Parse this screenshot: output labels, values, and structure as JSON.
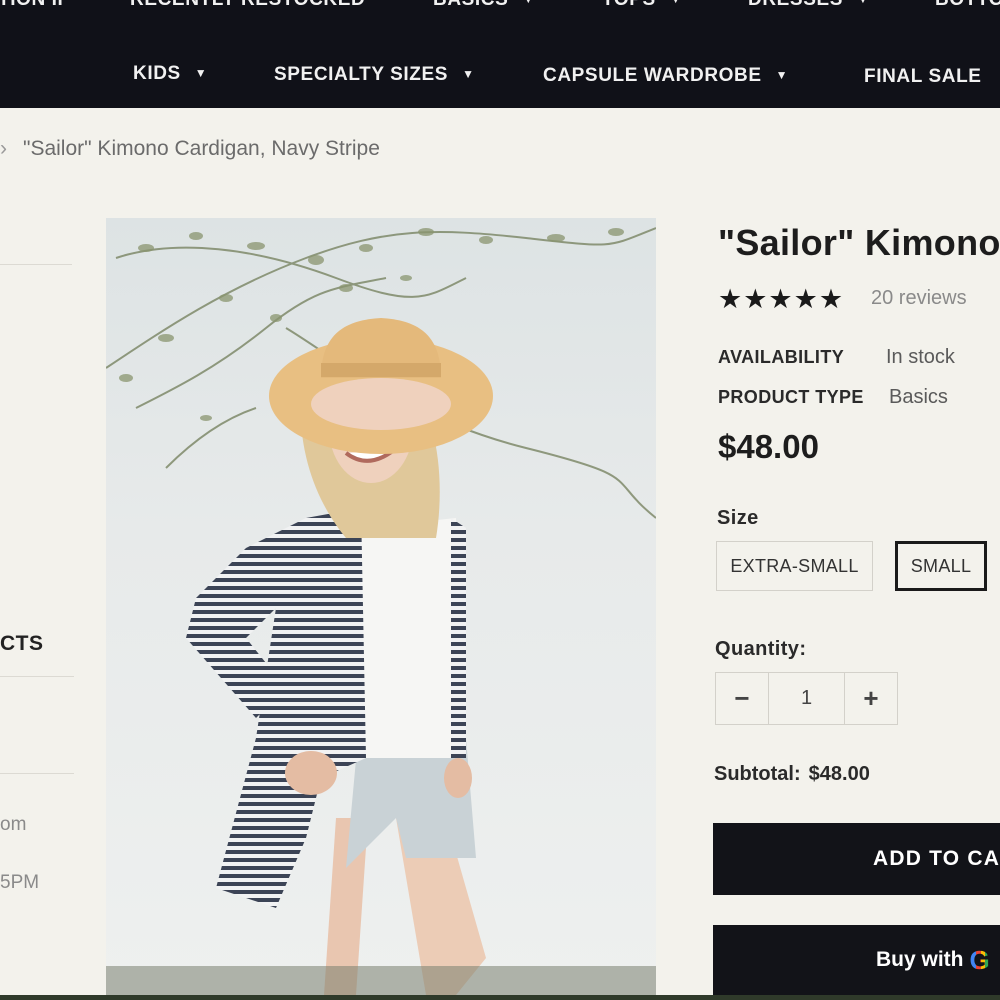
{
  "nav": {
    "top_row": [
      {
        "label": "TION II"
      },
      {
        "label": "RECENTLY RESTOCKED"
      },
      {
        "label": "BASICS"
      },
      {
        "label": "TOPS"
      },
      {
        "label": "DRESSES"
      },
      {
        "label": "BOTTO"
      }
    ],
    "bottom_row": [
      {
        "label": "KIDS"
      },
      {
        "label": "SPECIALTY SIZES"
      },
      {
        "label": "CAPSULE WARDROBE"
      },
      {
        "label": "FINAL SALE"
      }
    ]
  },
  "breadcrumb": {
    "separator": "›",
    "current": "\"Sailor\" Kimono Cardigan, Navy Stripe"
  },
  "sidebar": {
    "heading_fragment": "CTS",
    "text_fragment_1": "om",
    "text_fragment_2": "5PM"
  },
  "product": {
    "title": "\"Sailor\" Kimono",
    "rating_stars": "★★★★★",
    "rating_value": 5,
    "reviews": "20 reviews",
    "availability_label": "AVAILABILITY",
    "availability_value": "In stock",
    "type_label": "PRODUCT TYPE",
    "type_value": "Basics",
    "price": "$48.00",
    "size_label": "Size",
    "sizes": [
      {
        "label": "EXTRA-SMALL",
        "selected": false
      },
      {
        "label": "SMALL",
        "selected": true
      }
    ],
    "quantity_label": "Quantity:",
    "quantity_minus": "−",
    "quantity_value": "1",
    "quantity_plus": "+",
    "subtotal_label": "Subtotal:",
    "subtotal_value": "$48.00",
    "add_to_cart": "ADD TO CA",
    "buy_with": "Buy with",
    "buy_with_brand": "G"
  },
  "colors": {
    "nav_bg": "#101118",
    "page_bg": "#f3f2ec",
    "button_dark": "#121318",
    "text_dark": "#1d1d1d"
  }
}
